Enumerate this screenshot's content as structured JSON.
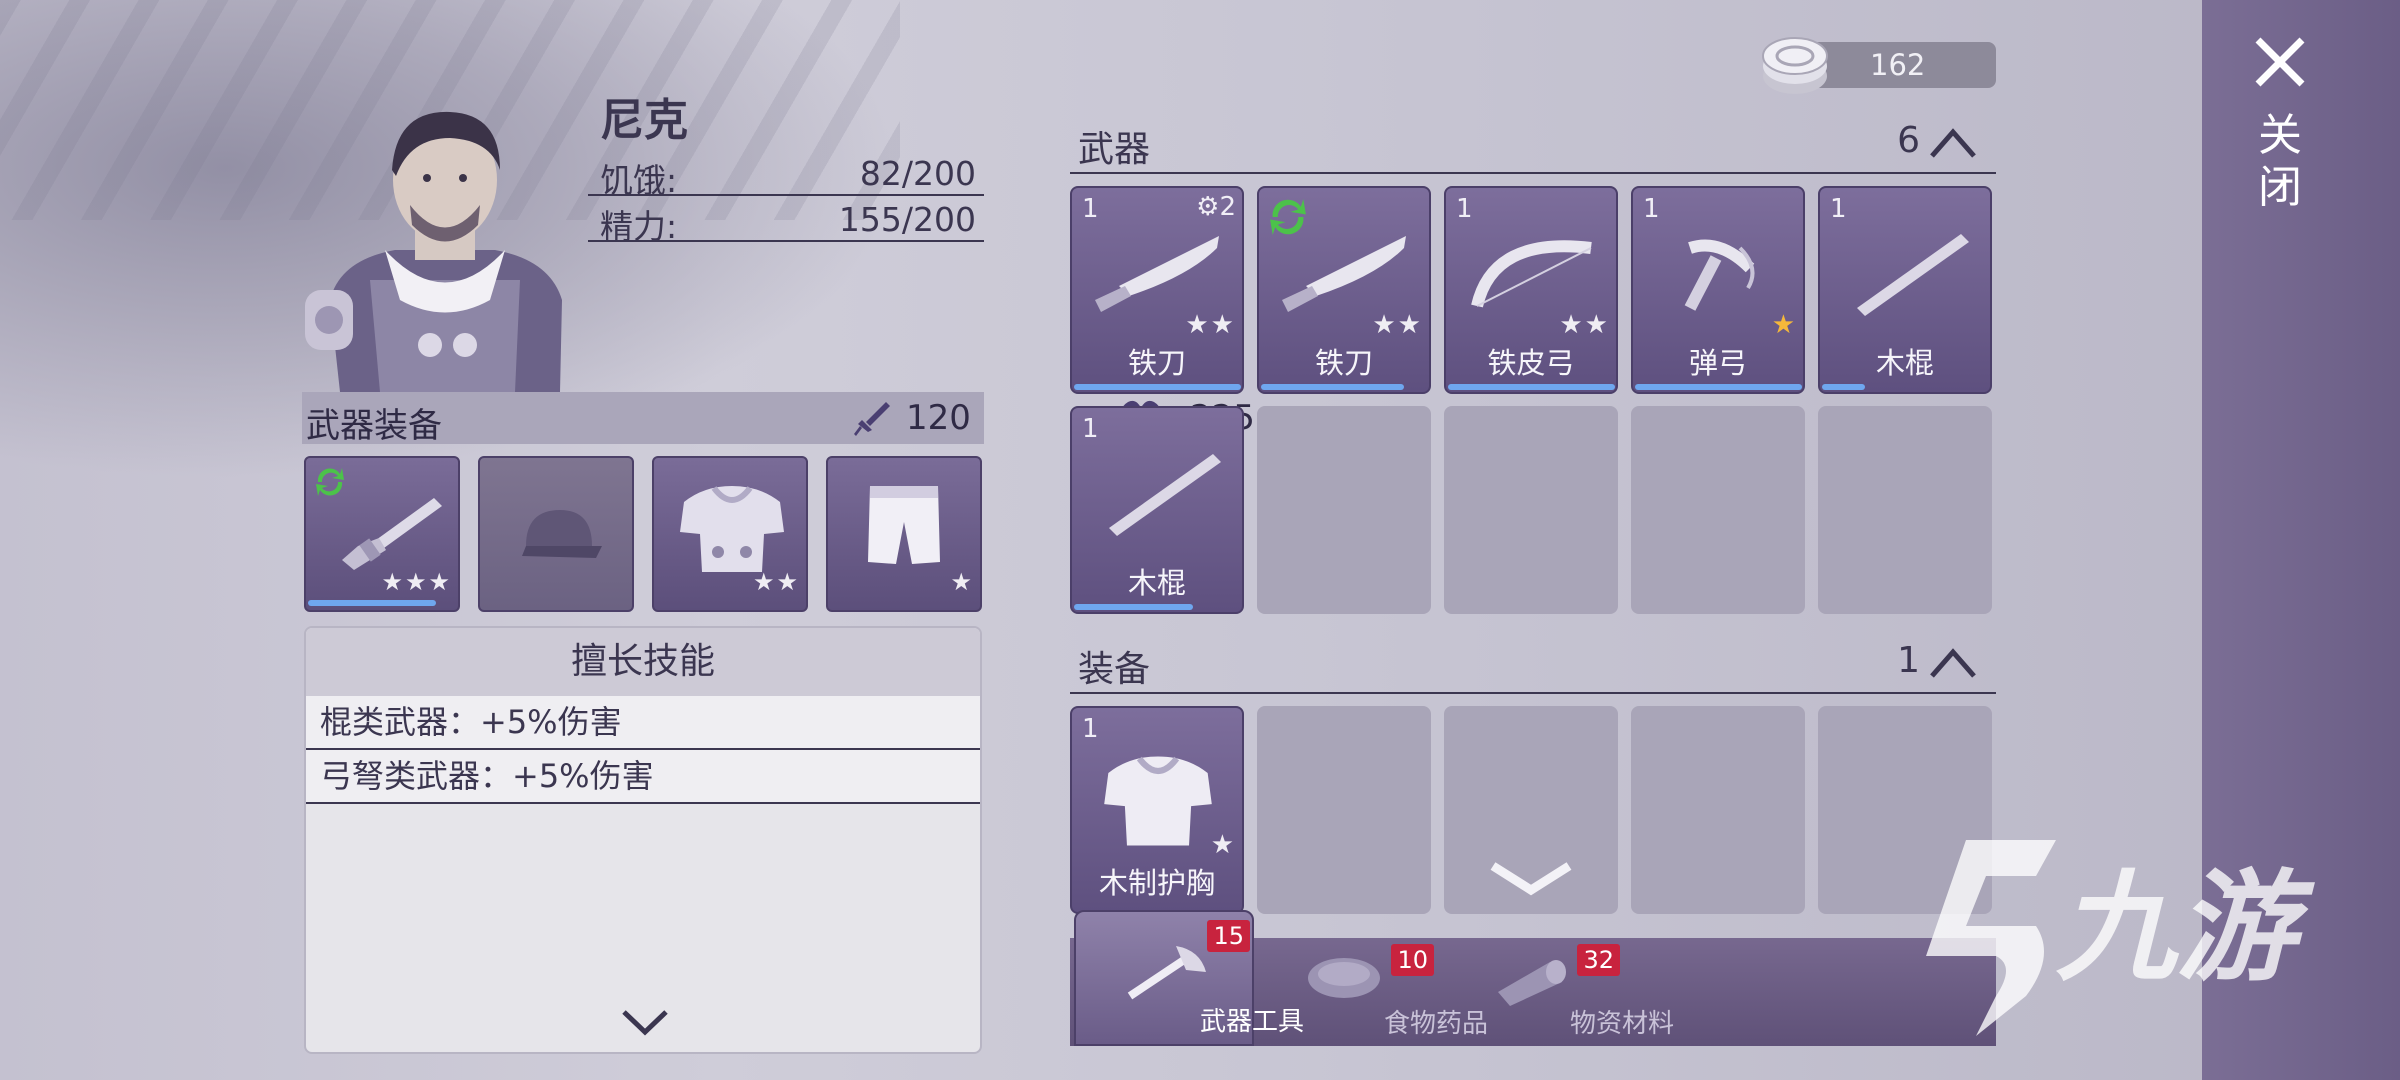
{
  "character": {
    "name": "尼克",
    "stats": [
      {
        "label": "饥饿:",
        "value": "82/200"
      },
      {
        "label": "精力:",
        "value": "155/200"
      }
    ]
  },
  "equipment": {
    "header": "武器装备",
    "attack": "120",
    "health": "225",
    "slots": [
      {
        "icon": "shotgun-icon",
        "stars": 3,
        "progress": 0.85,
        "refresh": true
      },
      {
        "icon": "cap-icon",
        "empty": true
      },
      {
        "icon": "armor-icon",
        "stars": 2
      },
      {
        "icon": "pants-icon",
        "stars": 1
      }
    ]
  },
  "skills": {
    "title": "擅长技能",
    "items": [
      "棍类武器：+5%伤害",
      "弓弩类武器：+5%伤害"
    ]
  },
  "currency": {
    "amount": "162"
  },
  "weapons": {
    "title": "武器",
    "count": "6",
    "items": [
      {
        "count": "1",
        "name": "铁刀",
        "stars": 2,
        "gear": "2",
        "icon": "knife-icon",
        "durability": 1.0
      },
      {
        "count": "",
        "name": "铁刀",
        "stars": 2,
        "icon": "knife-icon",
        "durability": 0.85,
        "refresh": true
      },
      {
        "count": "1",
        "name": "铁皮弓",
        "stars": 2,
        "icon": "bow-icon",
        "durability": 1.0
      },
      {
        "count": "1",
        "name": "弹弓",
        "stars": 1,
        "gold": true,
        "icon": "slingshot-icon",
        "durability": 1.0
      },
      {
        "count": "1",
        "name": "木棍",
        "stars": 0,
        "icon": "stick-icon",
        "durability": 0.25
      },
      {
        "count": "1",
        "name": "木棍",
        "stars": 0,
        "icon": "stick-icon",
        "durability": 0.7
      }
    ]
  },
  "gear": {
    "title": "装备",
    "count": "1",
    "items": [
      {
        "count": "1",
        "name": "木制护胸",
        "stars": 1,
        "icon": "chestplate-icon"
      }
    ]
  },
  "tabs": [
    {
      "label": "武器工具",
      "badge": "15",
      "icon": "axe-icon",
      "active": true
    },
    {
      "label": "食物药品",
      "badge": "10",
      "icon": "meat-icon"
    },
    {
      "label": "物资材料",
      "badge": "32",
      "icon": "log-icon"
    }
  ],
  "close": {
    "label": "关闭"
  },
  "watermark": "九游",
  "colors": {
    "panel": "#5e507f",
    "accent": "#6fa7ef",
    "badge": "#c8233e",
    "refresh": "#4cc24a"
  }
}
